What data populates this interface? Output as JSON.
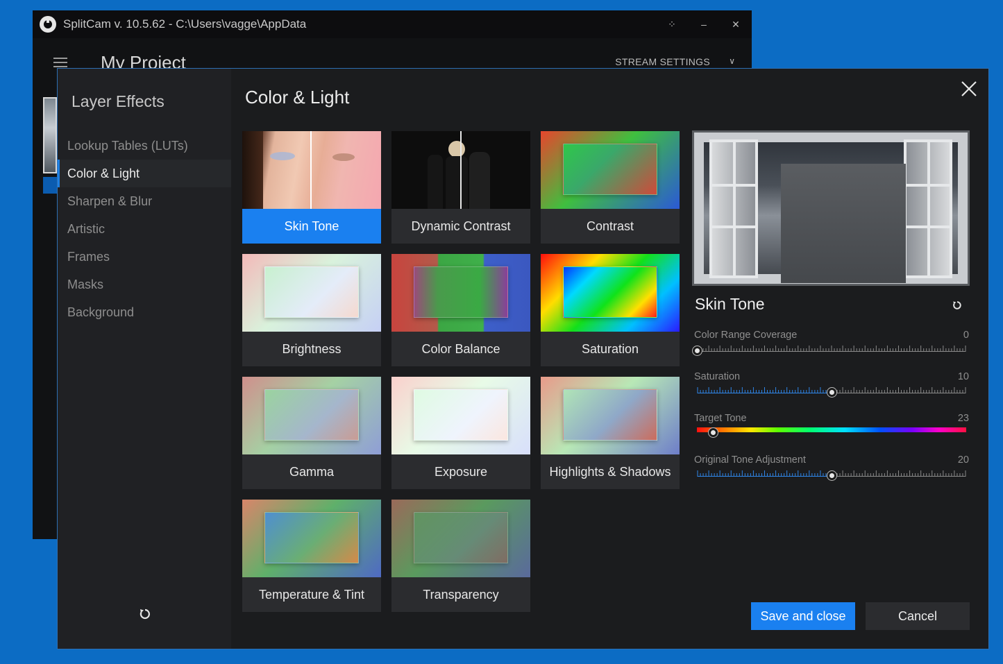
{
  "app": {
    "title": "SplitCam v. 10.5.62 - C:\\Users\\vagge\\AppData",
    "project_name": "My Project",
    "stream_settings": "STREAM SETTINGS"
  },
  "dialog": {
    "sidebar_title": "Layer Effects",
    "nav": [
      {
        "label": "Lookup Tables (LUTs)",
        "active": false
      },
      {
        "label": "Color & Light",
        "active": true
      },
      {
        "label": "Sharpen & Blur",
        "active": false
      },
      {
        "label": "Artistic",
        "active": false
      },
      {
        "label": "Frames",
        "active": false
      },
      {
        "label": "Masks",
        "active": false
      },
      {
        "label": "Background",
        "active": false
      }
    ],
    "section_title": "Color & Light",
    "effects": [
      {
        "label": "Skin Tone",
        "selected": true
      },
      {
        "label": "Dynamic Contrast",
        "selected": false
      },
      {
        "label": "Contrast",
        "selected": false
      },
      {
        "label": "Brightness",
        "selected": false
      },
      {
        "label": "Color Balance",
        "selected": false
      },
      {
        "label": "Saturation",
        "selected": false
      },
      {
        "label": "Gamma",
        "selected": false
      },
      {
        "label": "Exposure",
        "selected": false
      },
      {
        "label": "Highlights & Shadows",
        "selected": false
      },
      {
        "label": "Temperature & Tint",
        "selected": false
      },
      {
        "label": "Transparency",
        "selected": false
      }
    ],
    "panel": {
      "effect_title": "Skin Tone",
      "sliders": [
        {
          "label": "Color Range Coverage",
          "value": "0",
          "fraction": 0.0,
          "type": "ticks"
        },
        {
          "label": "Saturation",
          "value": "10",
          "fraction": 0.5,
          "type": "ticks"
        },
        {
          "label": "Target Tone",
          "value": "23",
          "fraction": 0.06,
          "type": "hue"
        },
        {
          "label": "Original Tone Adjustment",
          "value": "20",
          "fraction": 0.5,
          "type": "ticks"
        }
      ]
    },
    "buttons": {
      "save": "Save and close",
      "cancel": "Cancel"
    }
  },
  "colors": {
    "accent": "#1a80f0",
    "desktop": "#0c6cc4",
    "dialog_bg": "#1b1c1e"
  }
}
